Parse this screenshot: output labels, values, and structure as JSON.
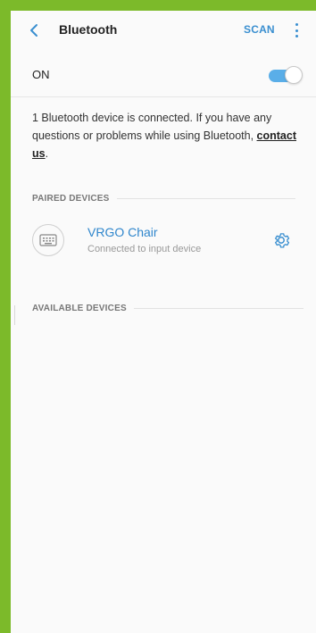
{
  "header": {
    "title": "Bluetooth",
    "scan_label": "SCAN"
  },
  "power": {
    "label": "ON",
    "enabled": true
  },
  "info": {
    "text": "1 Bluetooth device is connected. If you have any questions or problems while using Bluetooth, ",
    "link_label": "contact us",
    "suffix": "."
  },
  "paired": {
    "header": "PAIRED DEVICES",
    "devices": [
      {
        "name": "VRGO Chair",
        "status": "Connected to input device"
      }
    ]
  },
  "available": {
    "header": "AVAILABLE DEVICES"
  },
  "colors": {
    "accent": "#3a8fd0",
    "frame": "#7cba2a",
    "toggle_on": "#5aaee8"
  },
  "icons": {
    "back": "chevron-left-icon",
    "more": "more-vertical-icon",
    "device": "keyboard-icon",
    "settings": "gear-icon"
  }
}
